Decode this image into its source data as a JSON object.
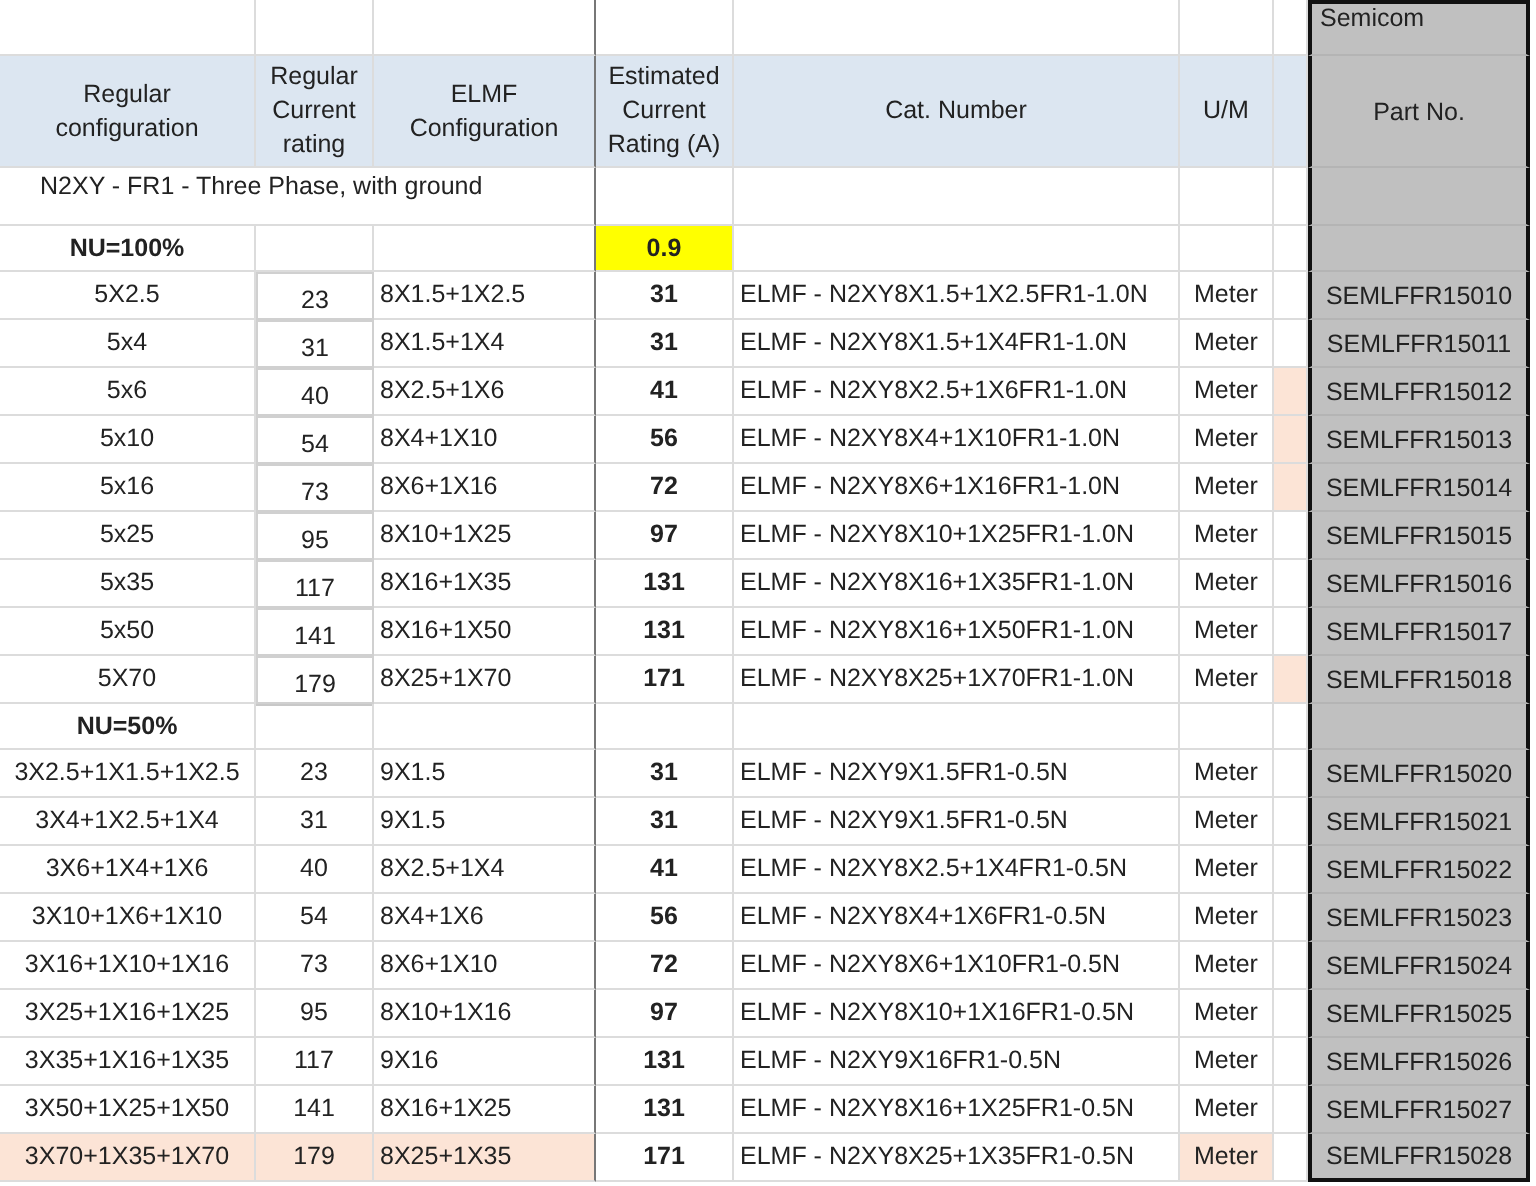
{
  "part_group_label": "Semicom",
  "headings": [
    "Regular configuration",
    "Regular Current rating",
    "ELMF Configuration",
    "Estimated Current Rating (A)",
    "Cat. Number",
    "U/M"
  ],
  "part_heading": "Part No.",
  "section_title": "N2XY - FR1 - Three Phase, with ground",
  "groups": [
    {
      "label": "NU=100%",
      "factor": "0.9",
      "rows": [
        {
          "config": "5X2.5",
          "rating": "23",
          "elmf": "8X1.5+1X2.5",
          "estimated": "31",
          "cat": "ELMF - N2XY8X1.5+1X2.5FR1-1.0N",
          "um": "Meter",
          "part": "SEMLFFR15010",
          "marked": false,
          "highlighted": false
        },
        {
          "config": "5x4",
          "rating": "31",
          "elmf": "8X1.5+1X4",
          "estimated": "31",
          "cat": "ELMF - N2XY8X1.5+1X4FR1-1.0N",
          "um": "Meter",
          "part": "SEMLFFR15011",
          "marked": false,
          "highlighted": false
        },
        {
          "config": "5x6",
          "rating": "40",
          "elmf": "8X2.5+1X6",
          "estimated": "41",
          "cat": "ELMF - N2XY8X2.5+1X6FR1-1.0N",
          "um": "Meter",
          "part": "SEMLFFR15012",
          "marked": true,
          "highlighted": false
        },
        {
          "config": "5x10",
          "rating": "54",
          "elmf": "8X4+1X10",
          "estimated": "56",
          "cat": "ELMF - N2XY8X4+1X10FR1-1.0N",
          "um": "Meter",
          "part": "SEMLFFR15013",
          "marked": true,
          "highlighted": false
        },
        {
          "config": "5x16",
          "rating": "73",
          "elmf": "8X6+1X16",
          "estimated": "72",
          "cat": "ELMF - N2XY8X6+1X16FR1-1.0N",
          "um": "Meter",
          "part": "SEMLFFR15014",
          "marked": true,
          "highlighted": false
        },
        {
          "config": "5x25",
          "rating": "95",
          "elmf": "8X10+1X25",
          "estimated": "97",
          "cat": "ELMF - N2XY8X10+1X25FR1-1.0N",
          "um": "Meter",
          "part": "SEMLFFR15015",
          "marked": false,
          "highlighted": false
        },
        {
          "config": "5x35",
          "rating": "117",
          "elmf": "8X16+1X35",
          "estimated": "131",
          "cat": "ELMF - N2XY8X16+1X35FR1-1.0N",
          "um": "Meter",
          "part": "SEMLFFR15016",
          "marked": false,
          "highlighted": false
        },
        {
          "config": "5x50",
          "rating": "141",
          "elmf": "8X16+1X50",
          "estimated": "131",
          "cat": "ELMF - N2XY8X16+1X50FR1-1.0N",
          "um": "Meter",
          "part": "SEMLFFR15017",
          "marked": false,
          "highlighted": false
        },
        {
          "config": "5X70",
          "rating": "179",
          "elmf": "8X25+1X70",
          "estimated": "171",
          "cat": "ELMF - N2XY8X25+1X70FR1-1.0N",
          "um": "Meter",
          "part": "SEMLFFR15018",
          "marked": true,
          "highlighted": false
        }
      ]
    },
    {
      "label": "NU=50%",
      "rows": [
        {
          "config": "3X2.5+1X1.5+1X2.5",
          "rating": "23",
          "elmf": "9X1.5",
          "estimated": "31",
          "cat": "ELMF - N2XY9X1.5FR1-0.5N",
          "um": "Meter",
          "part": "SEMLFFR15020",
          "marked": false,
          "highlighted": false
        },
        {
          "config": "3X4+1X2.5+1X4",
          "rating": "31",
          "elmf": "9X1.5",
          "estimated": "31",
          "cat": "ELMF - N2XY9X1.5FR1-0.5N",
          "um": "Meter",
          "part": "SEMLFFR15021",
          "marked": false,
          "highlighted": false
        },
        {
          "config": "3X6+1X4+1X6",
          "rating": "40",
          "elmf": "8X2.5+1X4",
          "estimated": "41",
          "cat": "ELMF - N2XY8X2.5+1X4FR1-0.5N",
          "um": "Meter",
          "part": "SEMLFFR15022",
          "marked": false,
          "highlighted": false
        },
        {
          "config": "3X10+1X6+1X10",
          "rating": "54",
          "elmf": "8X4+1X6",
          "estimated": "56",
          "cat": "ELMF - N2XY8X4+1X6FR1-0.5N",
          "um": "Meter",
          "part": "SEMLFFR15023",
          "marked": false,
          "highlighted": false
        },
        {
          "config": "3X16+1X10+1X16",
          "rating": "73",
          "elmf": "8X6+1X10",
          "estimated": "72",
          "cat": "ELMF - N2XY8X6+1X10FR1-0.5N",
          "um": "Meter",
          "part": "SEMLFFR15024",
          "marked": false,
          "highlighted": false
        },
        {
          "config": "3X25+1X16+1X25",
          "rating": "95",
          "elmf": "8X10+1X16",
          "estimated": "97",
          "cat": "ELMF - N2XY8X10+1X16FR1-0.5N",
          "um": "Meter",
          "part": "SEMLFFR15025",
          "marked": false,
          "highlighted": false
        },
        {
          "config": "3X35+1X16+1X35",
          "rating": "117",
          "elmf": "9X16",
          "estimated": "131",
          "cat": "ELMF - N2XY9X16FR1-0.5N",
          "um": "Meter",
          "part": "SEMLFFR15026",
          "marked": false,
          "highlighted": false
        },
        {
          "config": "3X50+1X25+1X50",
          "rating": "141",
          "elmf": "8X16+1X25",
          "estimated": "131",
          "cat": "ELMF - N2XY8X16+1X25FR1-0.5N",
          "um": "Meter",
          "part": "SEMLFFR15027",
          "marked": false,
          "highlighted": false
        },
        {
          "config": "3X70+1X35+1X70",
          "rating": "179",
          "elmf": "8X25+1X35",
          "estimated": "171",
          "cat": "ELMF - N2XY8X25+1X35FR1-0.5N",
          "um": "Meter",
          "part": "SEMLFFR15028",
          "marked": false,
          "highlighted": true
        }
      ]
    }
  ]
}
